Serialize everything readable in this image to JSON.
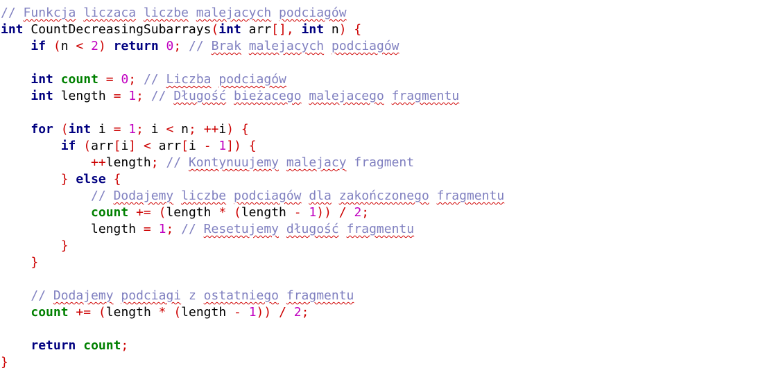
{
  "editor": {
    "language": "C/C++",
    "colors": {
      "background": "#ffffff",
      "keyword": "#000080",
      "number": "#c000c0",
      "operator": "#cc0000",
      "highlighted_identifier": "#008000",
      "comment": "#8080c0",
      "spellcheck_underline": "#d00000",
      "text": "#000000"
    },
    "lines": [
      [
        [
          "cm",
          "// "
        ],
        [
          "cmsq",
          "Funkcja"
        ],
        [
          "cm",
          " "
        ],
        [
          "cmsq",
          "liczaca"
        ],
        [
          "cm",
          " "
        ],
        [
          "cmsq",
          "liczbe"
        ],
        [
          "cm",
          " "
        ],
        [
          "cmsq",
          "malejacych"
        ],
        [
          "cm",
          " "
        ],
        [
          "cmsq",
          "podciagów"
        ]
      ],
      [
        [
          "kw",
          "int"
        ],
        [
          "id",
          " CountDecreasingSubarrays"
        ],
        [
          "op",
          "("
        ],
        [
          "kw",
          "int"
        ],
        [
          "id",
          " arr"
        ],
        [
          "op",
          "[],"
        ],
        [
          "id",
          " "
        ],
        [
          "kw",
          "int"
        ],
        [
          "id",
          " n"
        ],
        [
          "op",
          ")"
        ],
        [
          "id",
          " "
        ],
        [
          "op",
          "{"
        ]
      ],
      [
        [
          "id",
          "    "
        ],
        [
          "kw",
          "if"
        ],
        [
          "id",
          " "
        ],
        [
          "op",
          "("
        ],
        [
          "id",
          "n "
        ],
        [
          "op",
          "<"
        ],
        [
          "id",
          " "
        ],
        [
          "num",
          "2"
        ],
        [
          "op",
          ")"
        ],
        [
          "id",
          " "
        ],
        [
          "kw",
          "return"
        ],
        [
          "id",
          " "
        ],
        [
          "num",
          "0"
        ],
        [
          "op",
          ";"
        ],
        [
          "id",
          " "
        ],
        [
          "cm",
          "// "
        ],
        [
          "cmsq",
          "Brak"
        ],
        [
          "cm",
          " "
        ],
        [
          "cmsq",
          "malejacych"
        ],
        [
          "cm",
          " "
        ],
        [
          "cmsq",
          "podciagów"
        ]
      ],
      [],
      [
        [
          "id",
          "    "
        ],
        [
          "kw",
          "int"
        ],
        [
          "id",
          " "
        ],
        [
          "var",
          "count"
        ],
        [
          "id",
          " "
        ],
        [
          "op",
          "="
        ],
        [
          "id",
          " "
        ],
        [
          "num",
          "0"
        ],
        [
          "op",
          ";"
        ],
        [
          "id",
          " "
        ],
        [
          "cm",
          "// "
        ],
        [
          "cmsq",
          "Liczba"
        ],
        [
          "cm",
          " "
        ],
        [
          "cmsq",
          "podciagów"
        ]
      ],
      [
        [
          "id",
          "    "
        ],
        [
          "kw",
          "int"
        ],
        [
          "id",
          " length "
        ],
        [
          "op",
          "="
        ],
        [
          "id",
          " "
        ],
        [
          "num",
          "1"
        ],
        [
          "op",
          ";"
        ],
        [
          "id",
          " "
        ],
        [
          "cm",
          "// "
        ],
        [
          "cmsq",
          "Długość"
        ],
        [
          "cm",
          " "
        ],
        [
          "cmsq",
          "bieżacego"
        ],
        [
          "cm",
          " "
        ],
        [
          "cmsq",
          "malejacego"
        ],
        [
          "cm",
          " "
        ],
        [
          "cmsq",
          "fragmentu"
        ]
      ],
      [],
      [
        [
          "id",
          "    "
        ],
        [
          "kw",
          "for"
        ],
        [
          "id",
          " "
        ],
        [
          "op",
          "("
        ],
        [
          "kw",
          "int"
        ],
        [
          "id",
          " i "
        ],
        [
          "op",
          "="
        ],
        [
          "id",
          " "
        ],
        [
          "num",
          "1"
        ],
        [
          "op",
          ";"
        ],
        [
          "id",
          " i "
        ],
        [
          "op",
          "<"
        ],
        [
          "id",
          " n"
        ],
        [
          "op",
          ";"
        ],
        [
          "id",
          " "
        ],
        [
          "op",
          "++"
        ],
        [
          "id",
          "i"
        ],
        [
          "op",
          ")"
        ],
        [
          "id",
          " "
        ],
        [
          "op",
          "{"
        ]
      ],
      [
        [
          "id",
          "        "
        ],
        [
          "kw",
          "if"
        ],
        [
          "id",
          " "
        ],
        [
          "op",
          "("
        ],
        [
          "id",
          "arr"
        ],
        [
          "op",
          "["
        ],
        [
          "id",
          "i"
        ],
        [
          "op",
          "]"
        ],
        [
          "id",
          " "
        ],
        [
          "op",
          "<"
        ],
        [
          "id",
          " arr"
        ],
        [
          "op",
          "["
        ],
        [
          "id",
          "i "
        ],
        [
          "op",
          "-"
        ],
        [
          "id",
          " "
        ],
        [
          "num",
          "1"
        ],
        [
          "op",
          "])"
        ],
        [
          "id",
          " "
        ],
        [
          "op",
          "{"
        ]
      ],
      [
        [
          "id",
          "            "
        ],
        [
          "op",
          "++"
        ],
        [
          "id",
          "length"
        ],
        [
          "op",
          ";"
        ],
        [
          "id",
          " "
        ],
        [
          "cm",
          "// "
        ],
        [
          "cmsq",
          "Kontynuujemy"
        ],
        [
          "cm",
          " "
        ],
        [
          "cmsq",
          "malejacy"
        ],
        [
          "cm",
          " fragment"
        ]
      ],
      [
        [
          "id",
          "        "
        ],
        [
          "op",
          "}"
        ],
        [
          "id",
          " "
        ],
        [
          "kw",
          "else"
        ],
        [
          "id",
          " "
        ],
        [
          "op",
          "{"
        ]
      ],
      [
        [
          "id",
          "            "
        ],
        [
          "cm",
          "// "
        ],
        [
          "cmsq",
          "Dodajemy"
        ],
        [
          "cm",
          " "
        ],
        [
          "cmsq",
          "liczbe"
        ],
        [
          "cm",
          " "
        ],
        [
          "cmsq",
          "podciagów"
        ],
        [
          "cm",
          " "
        ],
        [
          "cmsq",
          "dla"
        ],
        [
          "cm",
          " "
        ],
        [
          "cmsq",
          "zakończonego"
        ],
        [
          "cm",
          " "
        ],
        [
          "cmsq",
          "fragmentu"
        ]
      ],
      [
        [
          "id",
          "            "
        ],
        [
          "var",
          "count"
        ],
        [
          "id",
          " "
        ],
        [
          "op",
          "+="
        ],
        [
          "id",
          " "
        ],
        [
          "op",
          "("
        ],
        [
          "id",
          "length "
        ],
        [
          "op",
          "*"
        ],
        [
          "id",
          " "
        ],
        [
          "op",
          "("
        ],
        [
          "id",
          "length "
        ],
        [
          "op",
          "-"
        ],
        [
          "id",
          " "
        ],
        [
          "num",
          "1"
        ],
        [
          "op",
          "))"
        ],
        [
          "id",
          " "
        ],
        [
          "op",
          "/"
        ],
        [
          "id",
          " "
        ],
        [
          "num",
          "2"
        ],
        [
          "op",
          ";"
        ]
      ],
      [
        [
          "id",
          "            length "
        ],
        [
          "op",
          "="
        ],
        [
          "id",
          " "
        ],
        [
          "num",
          "1"
        ],
        [
          "op",
          ";"
        ],
        [
          "id",
          " "
        ],
        [
          "cm",
          "// "
        ],
        [
          "cmsq",
          "Resetujemy"
        ],
        [
          "cm",
          " "
        ],
        [
          "cmsq",
          "długość"
        ],
        [
          "cm",
          " "
        ],
        [
          "cmsq",
          "fragmentu"
        ]
      ],
      [
        [
          "id",
          "        "
        ],
        [
          "op",
          "}"
        ]
      ],
      [
        [
          "id",
          "    "
        ],
        [
          "op",
          "}"
        ]
      ],
      [],
      [
        [
          "id",
          "    "
        ],
        [
          "cm",
          "// "
        ],
        [
          "cmsq",
          "Dodajemy"
        ],
        [
          "cm",
          " "
        ],
        [
          "cmsq",
          "podciagi"
        ],
        [
          "cm",
          " z "
        ],
        [
          "cmsq",
          "ostatniego"
        ],
        [
          "cm",
          " "
        ],
        [
          "cmsq",
          "fragmentu"
        ]
      ],
      [
        [
          "id",
          "    "
        ],
        [
          "var",
          "count"
        ],
        [
          "id",
          " "
        ],
        [
          "op",
          "+="
        ],
        [
          "id",
          " "
        ],
        [
          "op",
          "("
        ],
        [
          "id",
          "length "
        ],
        [
          "op",
          "*"
        ],
        [
          "id",
          " "
        ],
        [
          "op",
          "("
        ],
        [
          "id",
          "length "
        ],
        [
          "op",
          "-"
        ],
        [
          "id",
          " "
        ],
        [
          "num",
          "1"
        ],
        [
          "op",
          "))"
        ],
        [
          "id",
          " "
        ],
        [
          "op",
          "/"
        ],
        [
          "id",
          " "
        ],
        [
          "num",
          "2"
        ],
        [
          "op",
          ";"
        ]
      ],
      [],
      [
        [
          "id",
          "    "
        ],
        [
          "kw",
          "return"
        ],
        [
          "id",
          " "
        ],
        [
          "var",
          "count"
        ],
        [
          "op",
          ";"
        ]
      ],
      [
        [
          "op",
          "}"
        ]
      ]
    ]
  }
}
